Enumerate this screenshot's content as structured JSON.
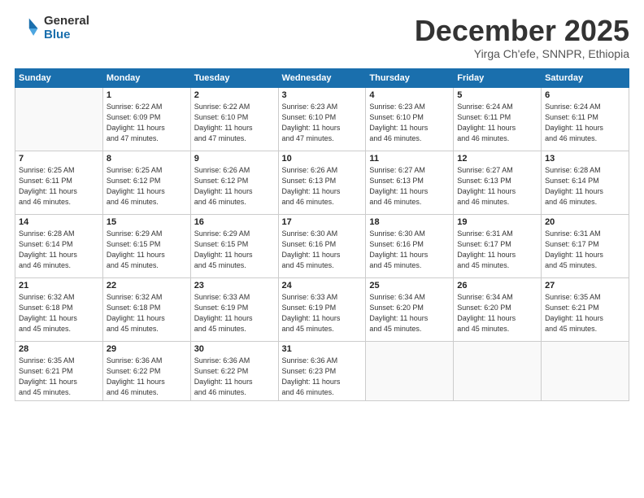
{
  "logo": {
    "general": "General",
    "blue": "Blue"
  },
  "title": "December 2025",
  "subtitle": "Yirga Ch'efe, SNNPR, Ethiopia",
  "days_of_week": [
    "Sunday",
    "Monday",
    "Tuesday",
    "Wednesday",
    "Thursday",
    "Friday",
    "Saturday"
  ],
  "weeks": [
    [
      {
        "day": "",
        "info": ""
      },
      {
        "day": "1",
        "info": "Sunrise: 6:22 AM\nSunset: 6:09 PM\nDaylight: 11 hours\nand 47 minutes."
      },
      {
        "day": "2",
        "info": "Sunrise: 6:22 AM\nSunset: 6:10 PM\nDaylight: 11 hours\nand 47 minutes."
      },
      {
        "day": "3",
        "info": "Sunrise: 6:23 AM\nSunset: 6:10 PM\nDaylight: 11 hours\nand 47 minutes."
      },
      {
        "day": "4",
        "info": "Sunrise: 6:23 AM\nSunset: 6:10 PM\nDaylight: 11 hours\nand 46 minutes."
      },
      {
        "day": "5",
        "info": "Sunrise: 6:24 AM\nSunset: 6:11 PM\nDaylight: 11 hours\nand 46 minutes."
      },
      {
        "day": "6",
        "info": "Sunrise: 6:24 AM\nSunset: 6:11 PM\nDaylight: 11 hours\nand 46 minutes."
      }
    ],
    [
      {
        "day": "7",
        "info": "Sunrise: 6:25 AM\nSunset: 6:11 PM\nDaylight: 11 hours\nand 46 minutes."
      },
      {
        "day": "8",
        "info": "Sunrise: 6:25 AM\nSunset: 6:12 PM\nDaylight: 11 hours\nand 46 minutes."
      },
      {
        "day": "9",
        "info": "Sunrise: 6:26 AM\nSunset: 6:12 PM\nDaylight: 11 hours\nand 46 minutes."
      },
      {
        "day": "10",
        "info": "Sunrise: 6:26 AM\nSunset: 6:13 PM\nDaylight: 11 hours\nand 46 minutes."
      },
      {
        "day": "11",
        "info": "Sunrise: 6:27 AM\nSunset: 6:13 PM\nDaylight: 11 hours\nand 46 minutes."
      },
      {
        "day": "12",
        "info": "Sunrise: 6:27 AM\nSunset: 6:13 PM\nDaylight: 11 hours\nand 46 minutes."
      },
      {
        "day": "13",
        "info": "Sunrise: 6:28 AM\nSunset: 6:14 PM\nDaylight: 11 hours\nand 46 minutes."
      }
    ],
    [
      {
        "day": "14",
        "info": "Sunrise: 6:28 AM\nSunset: 6:14 PM\nDaylight: 11 hours\nand 46 minutes."
      },
      {
        "day": "15",
        "info": "Sunrise: 6:29 AM\nSunset: 6:15 PM\nDaylight: 11 hours\nand 45 minutes."
      },
      {
        "day": "16",
        "info": "Sunrise: 6:29 AM\nSunset: 6:15 PM\nDaylight: 11 hours\nand 45 minutes."
      },
      {
        "day": "17",
        "info": "Sunrise: 6:30 AM\nSunset: 6:16 PM\nDaylight: 11 hours\nand 45 minutes."
      },
      {
        "day": "18",
        "info": "Sunrise: 6:30 AM\nSunset: 6:16 PM\nDaylight: 11 hours\nand 45 minutes."
      },
      {
        "day": "19",
        "info": "Sunrise: 6:31 AM\nSunset: 6:17 PM\nDaylight: 11 hours\nand 45 minutes."
      },
      {
        "day": "20",
        "info": "Sunrise: 6:31 AM\nSunset: 6:17 PM\nDaylight: 11 hours\nand 45 minutes."
      }
    ],
    [
      {
        "day": "21",
        "info": "Sunrise: 6:32 AM\nSunset: 6:18 PM\nDaylight: 11 hours\nand 45 minutes."
      },
      {
        "day": "22",
        "info": "Sunrise: 6:32 AM\nSunset: 6:18 PM\nDaylight: 11 hours\nand 45 minutes."
      },
      {
        "day": "23",
        "info": "Sunrise: 6:33 AM\nSunset: 6:19 PM\nDaylight: 11 hours\nand 45 minutes."
      },
      {
        "day": "24",
        "info": "Sunrise: 6:33 AM\nSunset: 6:19 PM\nDaylight: 11 hours\nand 45 minutes."
      },
      {
        "day": "25",
        "info": "Sunrise: 6:34 AM\nSunset: 6:20 PM\nDaylight: 11 hours\nand 45 minutes."
      },
      {
        "day": "26",
        "info": "Sunrise: 6:34 AM\nSunset: 6:20 PM\nDaylight: 11 hours\nand 45 minutes."
      },
      {
        "day": "27",
        "info": "Sunrise: 6:35 AM\nSunset: 6:21 PM\nDaylight: 11 hours\nand 45 minutes."
      }
    ],
    [
      {
        "day": "28",
        "info": "Sunrise: 6:35 AM\nSunset: 6:21 PM\nDaylight: 11 hours\nand 45 minutes."
      },
      {
        "day": "29",
        "info": "Sunrise: 6:36 AM\nSunset: 6:22 PM\nDaylight: 11 hours\nand 46 minutes."
      },
      {
        "day": "30",
        "info": "Sunrise: 6:36 AM\nSunset: 6:22 PM\nDaylight: 11 hours\nand 46 minutes."
      },
      {
        "day": "31",
        "info": "Sunrise: 6:36 AM\nSunset: 6:23 PM\nDaylight: 11 hours\nand 46 minutes."
      },
      {
        "day": "",
        "info": ""
      },
      {
        "day": "",
        "info": ""
      },
      {
        "day": "",
        "info": ""
      }
    ]
  ]
}
